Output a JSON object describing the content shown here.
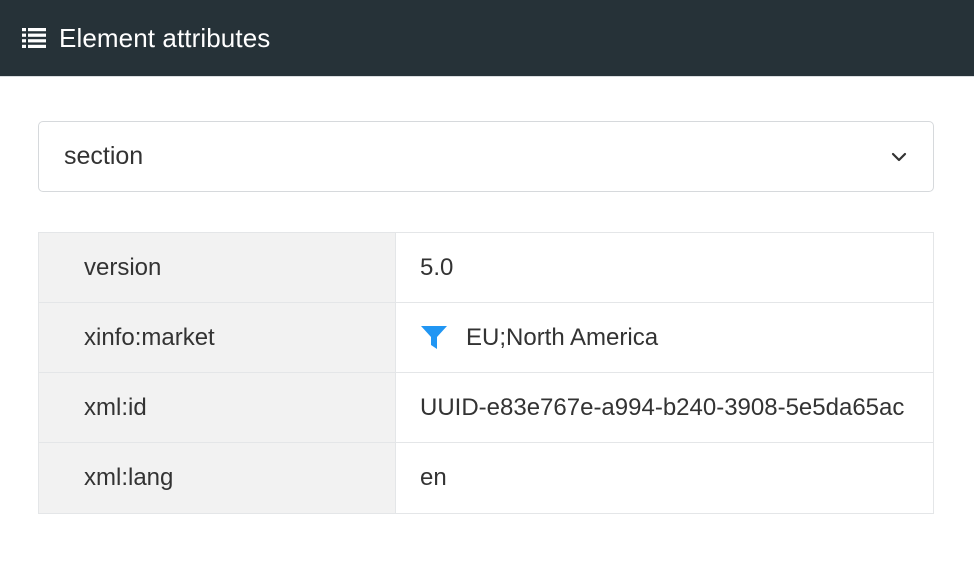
{
  "header": {
    "icon": "list-icon",
    "title": "Element attributes"
  },
  "element_select": {
    "selected": "section",
    "icon": "chevron-down-icon"
  },
  "attributes": [
    {
      "key": "version",
      "value": "5.0"
    },
    {
      "key": "xinfo:market",
      "value": "EU;North America",
      "icon": "filter-icon",
      "icon_color": "#2196f3"
    },
    {
      "key": "xml:id",
      "value": "UUID-e83e767e-a994-b240-3908-5e5da65ac"
    },
    {
      "key": "xml:lang",
      "value": "en"
    }
  ],
  "colors": {
    "header_bg": "#263238",
    "accent": "#2196f3"
  }
}
